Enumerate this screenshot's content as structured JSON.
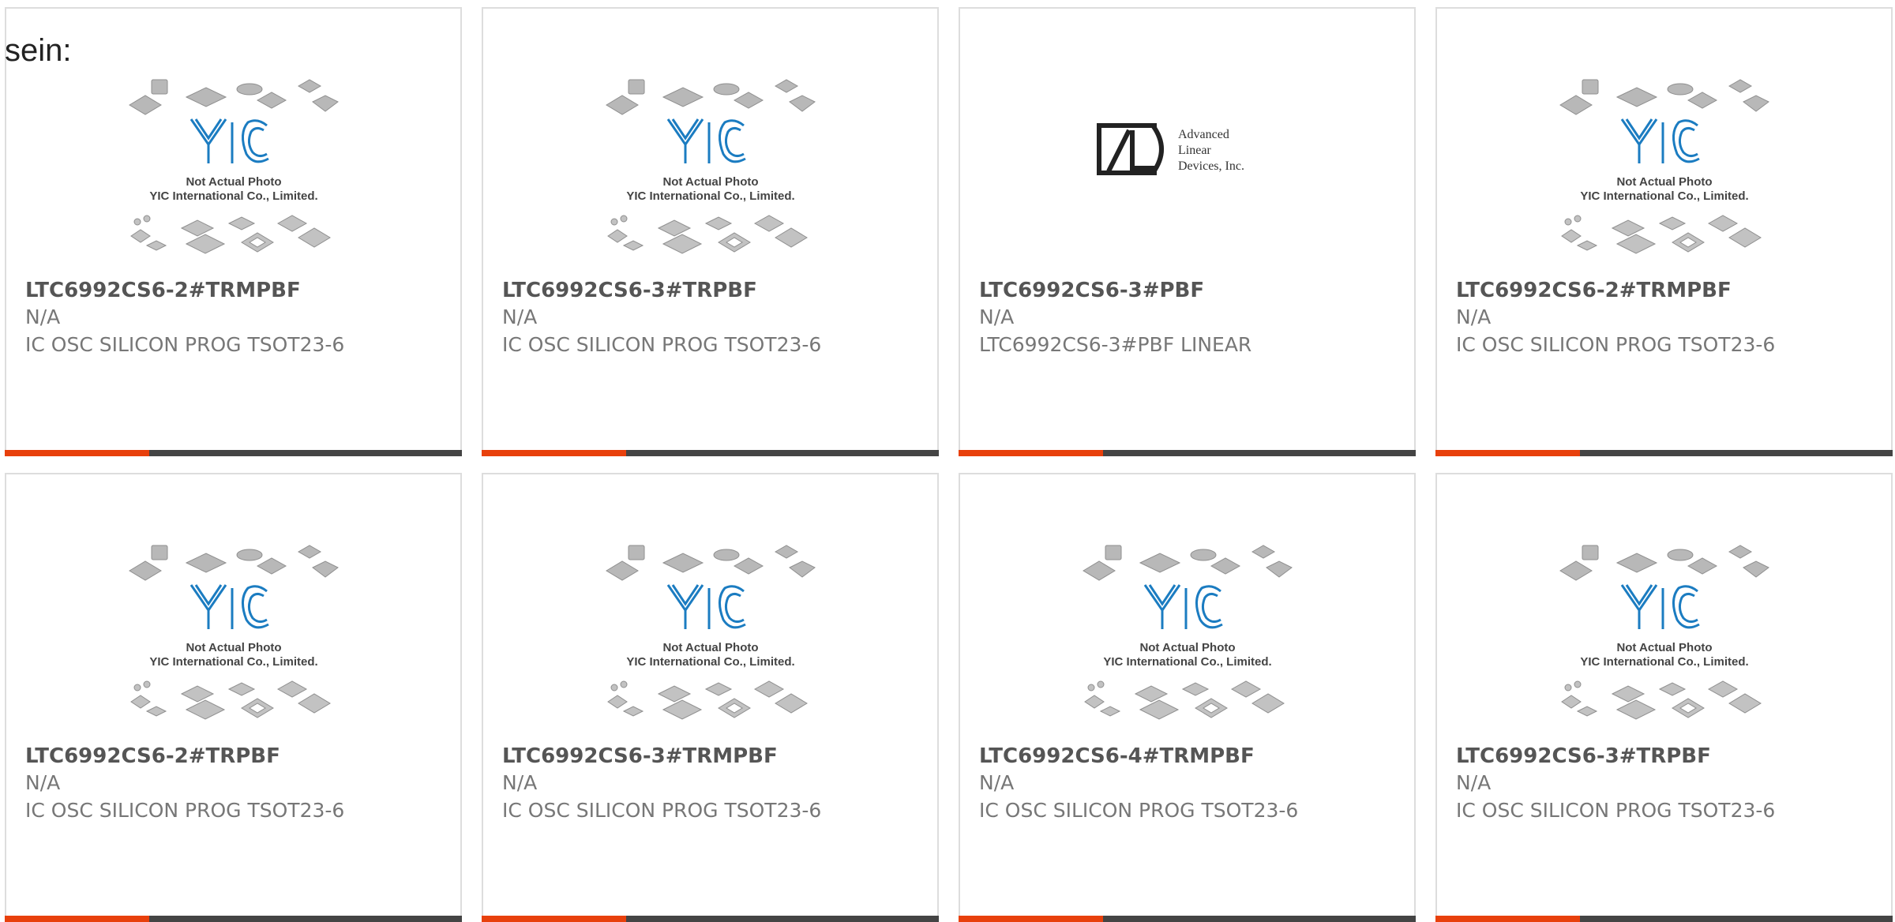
{
  "intro_text": "sein:",
  "photo_caption": {
    "line1": "Not Actual Photo",
    "line2": "YIC International Co., Limited."
  },
  "logo_yic": {
    "text": "YIC",
    "color": "#1b7cc1"
  },
  "logo_ald": {
    "line1": "Advanced",
    "line2": "Linear",
    "line3": "Devices, Inc."
  },
  "colors": {
    "accent_bar": "#e8400c",
    "dark_bar": "#444444",
    "card_border": "#dddddd"
  },
  "products": [
    {
      "part_number": "LTC6992CS6-2#TRMPBF",
      "manufacturer": "N/A",
      "description": "IC OSC SILICON PROG TSOT23-6",
      "image": "yic-placeholder"
    },
    {
      "part_number": "LTC6992CS6-3#TRPBF",
      "manufacturer": "N/A",
      "description": "IC OSC SILICON PROG TSOT23-6",
      "image": "yic-placeholder"
    },
    {
      "part_number": "LTC6992CS6-3#PBF",
      "manufacturer": "N/A",
      "description": "LTC6992CS6-3#PBF LINEAR",
      "image": "ald-logo"
    },
    {
      "part_number": "LTC6992CS6-2#TRMPBF",
      "manufacturer": "N/A",
      "description": "IC OSC SILICON PROG TSOT23-6",
      "image": "yic-placeholder"
    },
    {
      "part_number": "LTC6992CS6-2#TRPBF",
      "manufacturer": "N/A",
      "description": "IC OSC SILICON PROG TSOT23-6",
      "image": "yic-placeholder"
    },
    {
      "part_number": "LTC6992CS6-3#TRMPBF",
      "manufacturer": "N/A",
      "description": "IC OSC SILICON PROG TSOT23-6",
      "image": "yic-placeholder"
    },
    {
      "part_number": "LTC6992CS6-4#TRMPBF",
      "manufacturer": "N/A",
      "description": "IC OSC SILICON PROG TSOT23-6",
      "image": "yic-placeholder"
    },
    {
      "part_number": "LTC6992CS6-3#TRPBF",
      "manufacturer": "N/A",
      "description": "IC OSC SILICON PROG TSOT23-6",
      "image": "yic-placeholder"
    }
  ]
}
